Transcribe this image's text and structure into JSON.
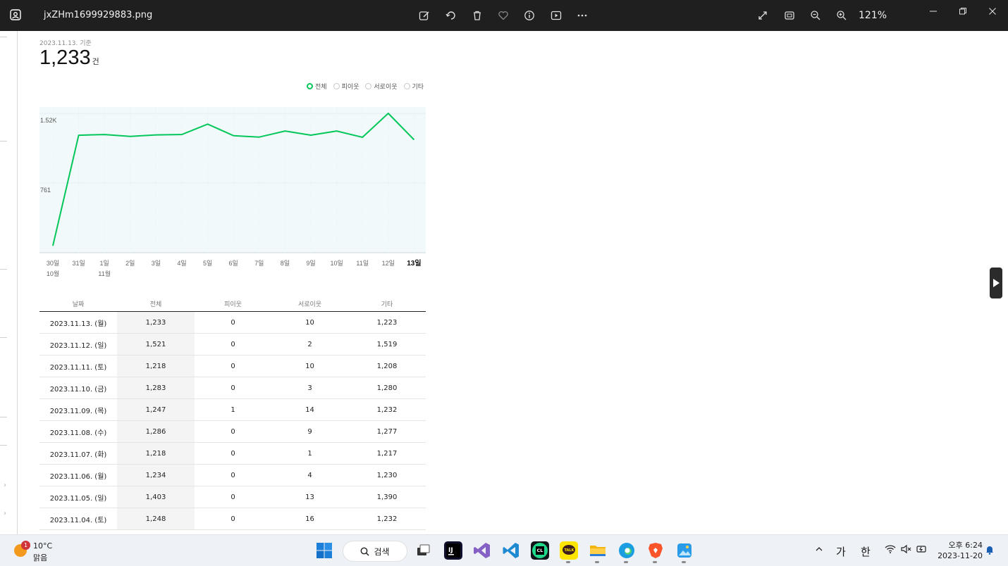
{
  "window": {
    "filename": "jxZHm1699929883.png",
    "zoom_label": "121%",
    "toolbar_icons": [
      "edit-icon",
      "rotate-icon",
      "delete-icon",
      "favorite-icon",
      "info-icon",
      "slideshow-icon",
      "more-icon"
    ],
    "view_icons": [
      "fullscreen-icon",
      "fit-icon",
      "zoom-out-icon",
      "zoom-in-icon"
    ]
  },
  "summary": {
    "basis_label": "2023.11.13. 기준",
    "total_value": "1,233",
    "total_unit": "건"
  },
  "legend": [
    {
      "label": "전체",
      "selected": true
    },
    {
      "label": "피이웃",
      "selected": false
    },
    {
      "label": "서로이웃",
      "selected": false
    },
    {
      "label": "기타",
      "selected": false
    }
  ],
  "colors": {
    "accent": "#03c75a",
    "chart_bg": "#f2f9fb",
    "titlebar": "#1f1f1f"
  },
  "chart_data": {
    "type": "line",
    "categories": [
      "30일",
      "31일",
      "1일",
      "2일",
      "3일",
      "4일",
      "5일",
      "6일",
      "7일",
      "8일",
      "9일",
      "10일",
      "11일",
      "12일",
      "13일"
    ],
    "month_labels": {
      "0": "10월",
      "2": "11월"
    },
    "series": [
      {
        "name": "전체",
        "values": [
          76,
          1282,
          1290,
          1269,
          1286,
          1290,
          1403,
          1277,
          1262,
          1328,
          1283,
          1328,
          1260,
          1521,
          1233
        ]
      }
    ],
    "y_ticks": [
      {
        "value": 761,
        "label": "761"
      },
      {
        "value": 1520,
        "label": "1.52K"
      }
    ],
    "ylim": [
      0,
      1590
    ],
    "grid": true,
    "highlight_last": true
  },
  "table": {
    "headers": [
      "날짜",
      "전체",
      "피이웃",
      "서로이웃",
      "기타"
    ],
    "rows": [
      [
        "2023.11.13. (월)",
        "1,233",
        "0",
        "10",
        "1,223"
      ],
      [
        "2023.11.12. (일)",
        "1,521",
        "0",
        "2",
        "1,519"
      ],
      [
        "2023.11.11. (토)",
        "1,218",
        "0",
        "10",
        "1,208"
      ],
      [
        "2023.11.10. (금)",
        "1,283",
        "0",
        "3",
        "1,280"
      ],
      [
        "2023.11.09. (목)",
        "1,247",
        "1",
        "14",
        "1,232"
      ],
      [
        "2023.11.08. (수)",
        "1,286",
        "0",
        "9",
        "1,277"
      ],
      [
        "2023.11.07. (화)",
        "1,218",
        "0",
        "1",
        "1,217"
      ],
      [
        "2023.11.06. (월)",
        "1,234",
        "0",
        "4",
        "1,230"
      ],
      [
        "2023.11.05. (일)",
        "1,403",
        "0",
        "13",
        "1,390"
      ],
      [
        "2023.11.04. (토)",
        "1,248",
        "0",
        "16",
        "1,232"
      ]
    ]
  },
  "taskbar": {
    "weather_badge": "1",
    "temperature": "10°C",
    "condition": "맑음",
    "search_label": "검색",
    "tray_chars": [
      "가",
      "한"
    ],
    "time": "오후 6:24",
    "date": "2023-11-20"
  }
}
